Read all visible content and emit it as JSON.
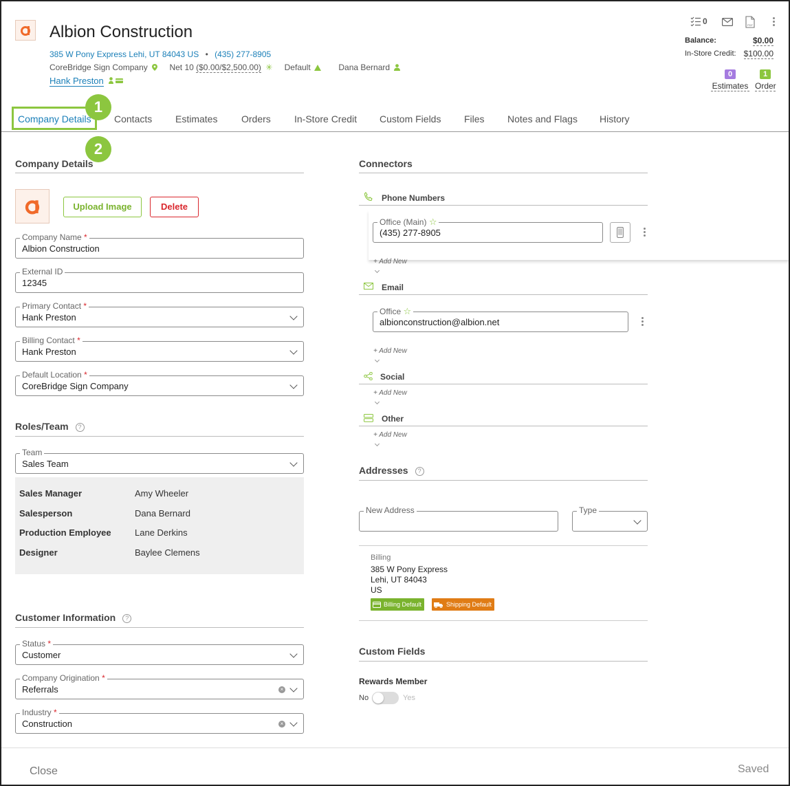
{
  "header": {
    "company_name": "Albion Construction",
    "address": "385 W Pony Express Lehi, UT 84043 US",
    "separator": "•",
    "phone": "(435) 277-8905",
    "location": "CoreBridge Sign Company",
    "terms": "Net 10",
    "terms_detail": "($0.00/$2,500.00)",
    "tax_group": "Default",
    "salesperson": "Dana Bernard",
    "primary_contact": "Hank Preston",
    "tasks_count": "0",
    "pdf_label": "PDF",
    "balance_label": "Balance:",
    "balance_value": "$0.00",
    "credit_label": "In-Store Credit:",
    "credit_value": "$100.00",
    "estimates_count": "0",
    "estimates_label": "Estimates",
    "orders_count": "1",
    "orders_label": "Order"
  },
  "tabs": [
    "Company Details",
    "Contacts",
    "Estimates",
    "Orders",
    "In-Store Credit",
    "Custom Fields",
    "Files",
    "Notes and Flags",
    "History"
  ],
  "callouts": [
    "1",
    "2"
  ],
  "company_details": {
    "title": "Company Details",
    "upload_label": "Upload Image",
    "delete_label": "Delete",
    "fields": [
      {
        "label": "Company Name",
        "required": "*",
        "value": "Albion Construction"
      },
      {
        "label": "External ID",
        "required": "",
        "value": "12345"
      },
      {
        "label": "Primary Contact",
        "required": "*",
        "value": "Hank Preston"
      },
      {
        "label": "Billing Contact",
        "required": "*",
        "value": "Hank Preston"
      },
      {
        "label": "Default Location",
        "required": "*",
        "value": "CoreBridge Sign Company"
      }
    ]
  },
  "roles": {
    "title": "Roles/Team",
    "help": "?",
    "team_label": "Team",
    "team_value": "Sales Team",
    "rows": [
      {
        "role": "Sales Manager",
        "name": "Amy Wheeler"
      },
      {
        "role": "Salesperson",
        "name": "Dana Bernard"
      },
      {
        "role": "Production Employee",
        "name": "Lane Derkins"
      },
      {
        "role": "Designer",
        "name": "Baylee Clemens"
      }
    ]
  },
  "customer_info": {
    "title": "Customer Information",
    "help": "?",
    "clear": "×",
    "fields": [
      {
        "label": "Status",
        "required": "*",
        "value": "Customer"
      },
      {
        "label": "Company Origination",
        "required": "*",
        "value": "Referrals"
      },
      {
        "label": "Industry",
        "required": "*",
        "value": "Construction"
      }
    ]
  },
  "connectors": {
    "title": "Connectors",
    "phone_title": "Phone Numbers",
    "phone_label": "Office (Main)",
    "phone_value": "(435) 277-8905",
    "email_title": "Email",
    "email_label": "Office",
    "email_value": "albionconstruction@albion.net",
    "social_title": "Social",
    "other_title": "Other",
    "add_new": "+ Add New",
    "star": "☆"
  },
  "addresses": {
    "title": "Addresses",
    "help": "?",
    "new_label": "New Address",
    "type_label": "Type",
    "billing_label": "Billing",
    "line1": "385 W Pony Express",
    "line2": "Lehi, UT 84043",
    "line3": "US",
    "billing_default": "Billing Default",
    "shipping_default": "Shipping Default"
  },
  "custom_fields": {
    "title": "Custom Fields",
    "rewards_label": "Rewards Member",
    "no_label": "No",
    "yes_label": "Yes"
  },
  "footer": {
    "close_label": "Close",
    "saved_label": "Saved"
  },
  "colors": {
    "accent_green": "#8cc63f",
    "link_blue": "#1a7fb8",
    "delete_red": "#d9262c",
    "estimates_purple": "#a57be0",
    "billing_badge": "#7ab32e",
    "shipping_badge": "#e07c15"
  }
}
